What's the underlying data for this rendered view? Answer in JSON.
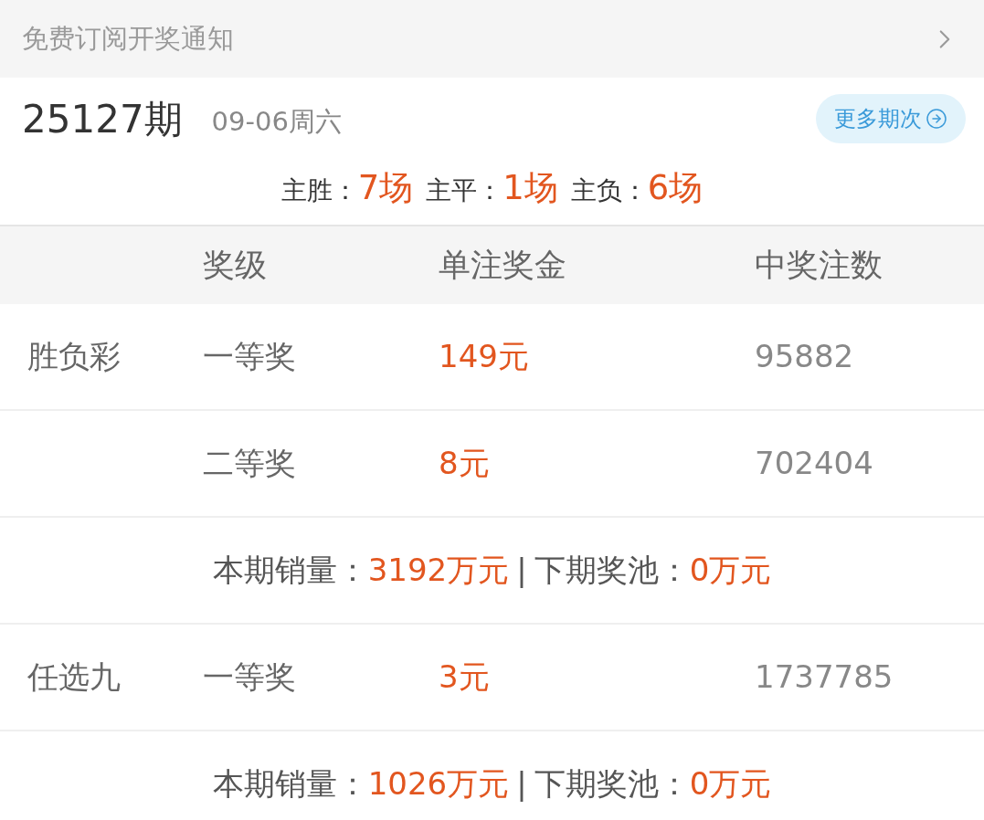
{
  "subscribe_bar": {
    "label": "免费订阅开奖通知"
  },
  "draw": {
    "issue": "25127期",
    "date": "09-06周六",
    "more_button": "更多期次"
  },
  "results": [
    {
      "label": "主胜：",
      "value": "7场"
    },
    {
      "label": "主平：",
      "value": "1场"
    },
    {
      "label": "主负：",
      "value": "6场"
    }
  ],
  "table": {
    "columns": [
      "奖级",
      "单注奖金",
      "中奖注数"
    ],
    "sections": [
      {
        "game": "胜负彩",
        "rows": [
          {
            "level": "一等奖",
            "prize": "149元",
            "winners": "95882"
          },
          {
            "level": "二等奖",
            "prize": "8元",
            "winners": "702404"
          }
        ],
        "summary": {
          "sales_label": "本期销量：",
          "sales": "3192万元",
          "separator": "|",
          "pool_label": "下期奖池：",
          "pool": "0万元"
        }
      },
      {
        "game": "任选九",
        "rows": [
          {
            "level": "一等奖",
            "prize": "3元",
            "winners": "1737785"
          }
        ],
        "summary": {
          "sales_label": "本期销量：",
          "sales": "1026万元",
          "separator": "|",
          "pool_label": "下期奖池：",
          "pool": "0万元"
        }
      }
    ]
  }
}
